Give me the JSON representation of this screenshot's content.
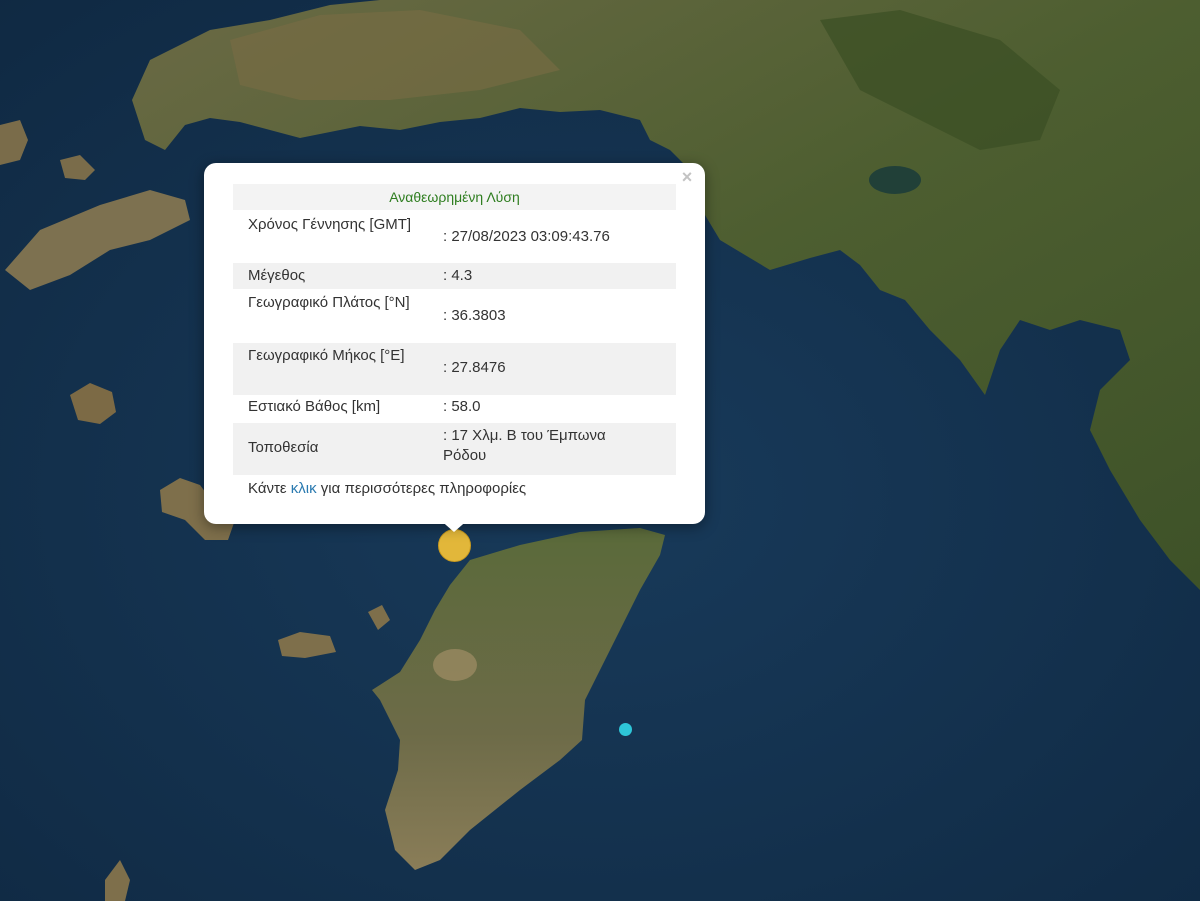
{
  "map": {
    "base": "satellite",
    "colors": {
      "sea": "#112c46",
      "land_green": "#4a5e2e",
      "land_dry": "#8a7a55"
    }
  },
  "popup": {
    "title": "Αναθεωρημένη Λύση",
    "close_icon": "×",
    "rows": [
      {
        "label": "Χρόνος Γέννησης [GMT]",
        "value": ": 27/08/2023 03:09:43.76"
      },
      {
        "label": "Μέγεθος",
        "value": ": 4.3"
      },
      {
        "label": "Γεωγραφικό Πλάτος [°N]",
        "value": ": 36.3803"
      },
      {
        "label": "Γεωγραφικό Μήκος [°E]",
        "value": ": 27.8476"
      },
      {
        "label": "Εστιακό Βάθος [km]",
        "value": ": 58.0"
      },
      {
        "label": "Τοποθεσία",
        "value": ": 17 Χλμ. Β του Έμπωνα Ρόδου"
      }
    ],
    "footer": {
      "prefix": "Κάντε ",
      "link": "κλικ",
      "suffix": " για περισσότερες πληροφορίες"
    }
  },
  "markers": {
    "earthquake_color": "#e2b73a",
    "other_color": "#2ec6d8"
  }
}
